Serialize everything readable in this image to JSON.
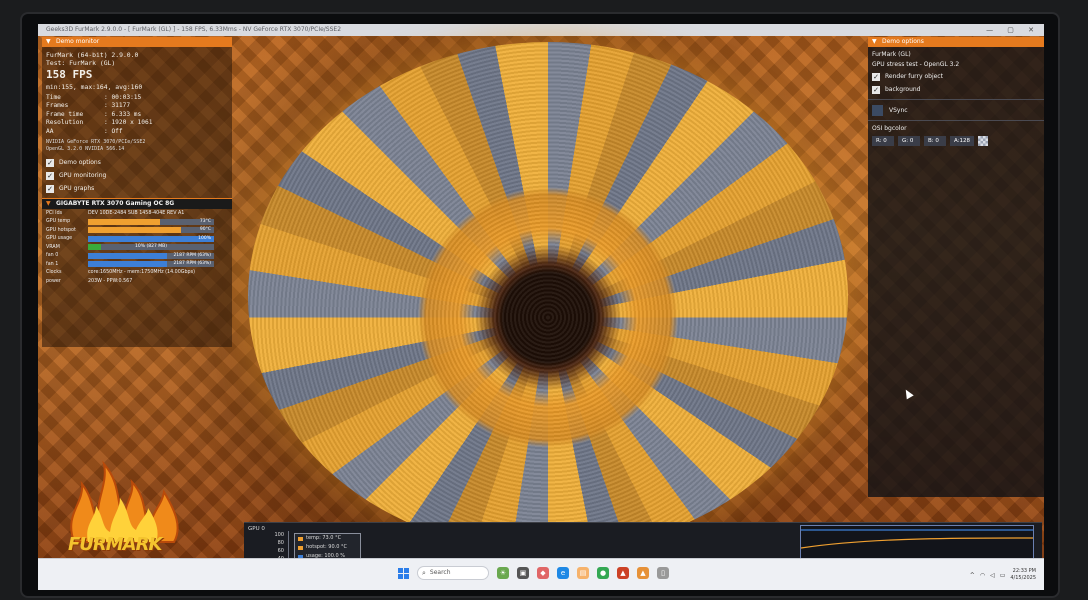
{
  "window": {
    "title": "Geeks3D FurMark 2.9.0.0 - [ FurMark (GL) ] - 158 FPS, 6.33Mms - NV GeForce RTX 3070/PCIe/SSE2"
  },
  "demo_monitor": {
    "header": "Demo monitor",
    "app_line": "FurMark (64-bit) 2.9.0.0",
    "test_line": "Test: FurMark (GL)",
    "fps": "158 FPS",
    "fps_stats": "min:155, max:164, avg:160",
    "stats": [
      {
        "label": "Time",
        "value": ": 00:03:15"
      },
      {
        "label": "Frames",
        "value": ": 31177"
      },
      {
        "label": "Frame time",
        "value": ": 6.333 ms"
      },
      {
        "label": "Resolution",
        "value": ": 1920 x 1061"
      },
      {
        "label": "AA",
        "value": ": Off"
      }
    ],
    "renderer_lines": [
      "NVIDIA GeForce RTX 3070/PCIe/SSE2",
      "OpenGL 3.2.0 NVIDIA 566.14"
    ],
    "checkboxes": [
      {
        "label": "Demo options",
        "checked": true
      },
      {
        "label": "GPU monitoring",
        "checked": true
      },
      {
        "label": "GPU graphs",
        "checked": true
      }
    ]
  },
  "gpu_panel": {
    "header": "GIGABYTE RTX 3070 Gaming OC 8G",
    "pci_label": "PCI Ids",
    "pci_value": "DEV 10DE-2484  SUB 1458-404E  REV A1",
    "rows": [
      {
        "label": "GPU temp",
        "text": "73°C",
        "fill": 0.57,
        "color": "#f0a030"
      },
      {
        "label": "GPU hotspot",
        "text": "90°C",
        "fill": 0.74,
        "color": "#f0a030"
      },
      {
        "label": "GPU usage",
        "text": "100%",
        "fill": 1.0,
        "color": "#3d7fd6"
      },
      {
        "label": "VRAM",
        "text": "10% (827 MB)",
        "fill": 0.1,
        "color": "#3aaa3a"
      },
      {
        "label": "fan 0",
        "text": "2187 RPM (63%)",
        "fill": 0.63,
        "color": "#3d7fd6"
      },
      {
        "label": "fan 1",
        "text": "2187 RPM (63%)",
        "fill": 0.63,
        "color": "#3d7fd6"
      }
    ],
    "clocks_label": "Clocks",
    "clocks_value": "core:1650MHz - mem:1750MHz (14.00Gbps)",
    "power_label": "power",
    "power_value": "203W - PPW:0.567"
  },
  "demo_options": {
    "header": "Demo options",
    "title": "FurMark (GL)",
    "subtitle": "GPU stress test - OpenGL 3.2",
    "checkboxes": [
      {
        "label": "Render furry object",
        "checked": true
      },
      {
        "label": "background",
        "checked": true
      }
    ],
    "vsync_label": "VSync",
    "bgcolor_label": "OSI bgcolor",
    "bgcolor": {
      "r": "R: 0",
      "g": "G: 0",
      "b": "B: 0",
      "a": "A:128"
    }
  },
  "logo_text": "FURMARK",
  "gpu_graph": {
    "label": "GPU 0",
    "ticks": [
      "100",
      "80",
      "60",
      "40"
    ],
    "legend": [
      {
        "text": "temp: 73.0 °C",
        "color": "#f0a030"
      },
      {
        "text": "hotspot: 90.0 °C",
        "color": "#f0a030"
      },
      {
        "text": "usage: 100.0 %",
        "color": "#3d7fd6"
      }
    ]
  },
  "taskbar": {
    "search_placeholder": "Search",
    "clock_time": "22:33 PM",
    "clock_date": "4/15/2025"
  }
}
